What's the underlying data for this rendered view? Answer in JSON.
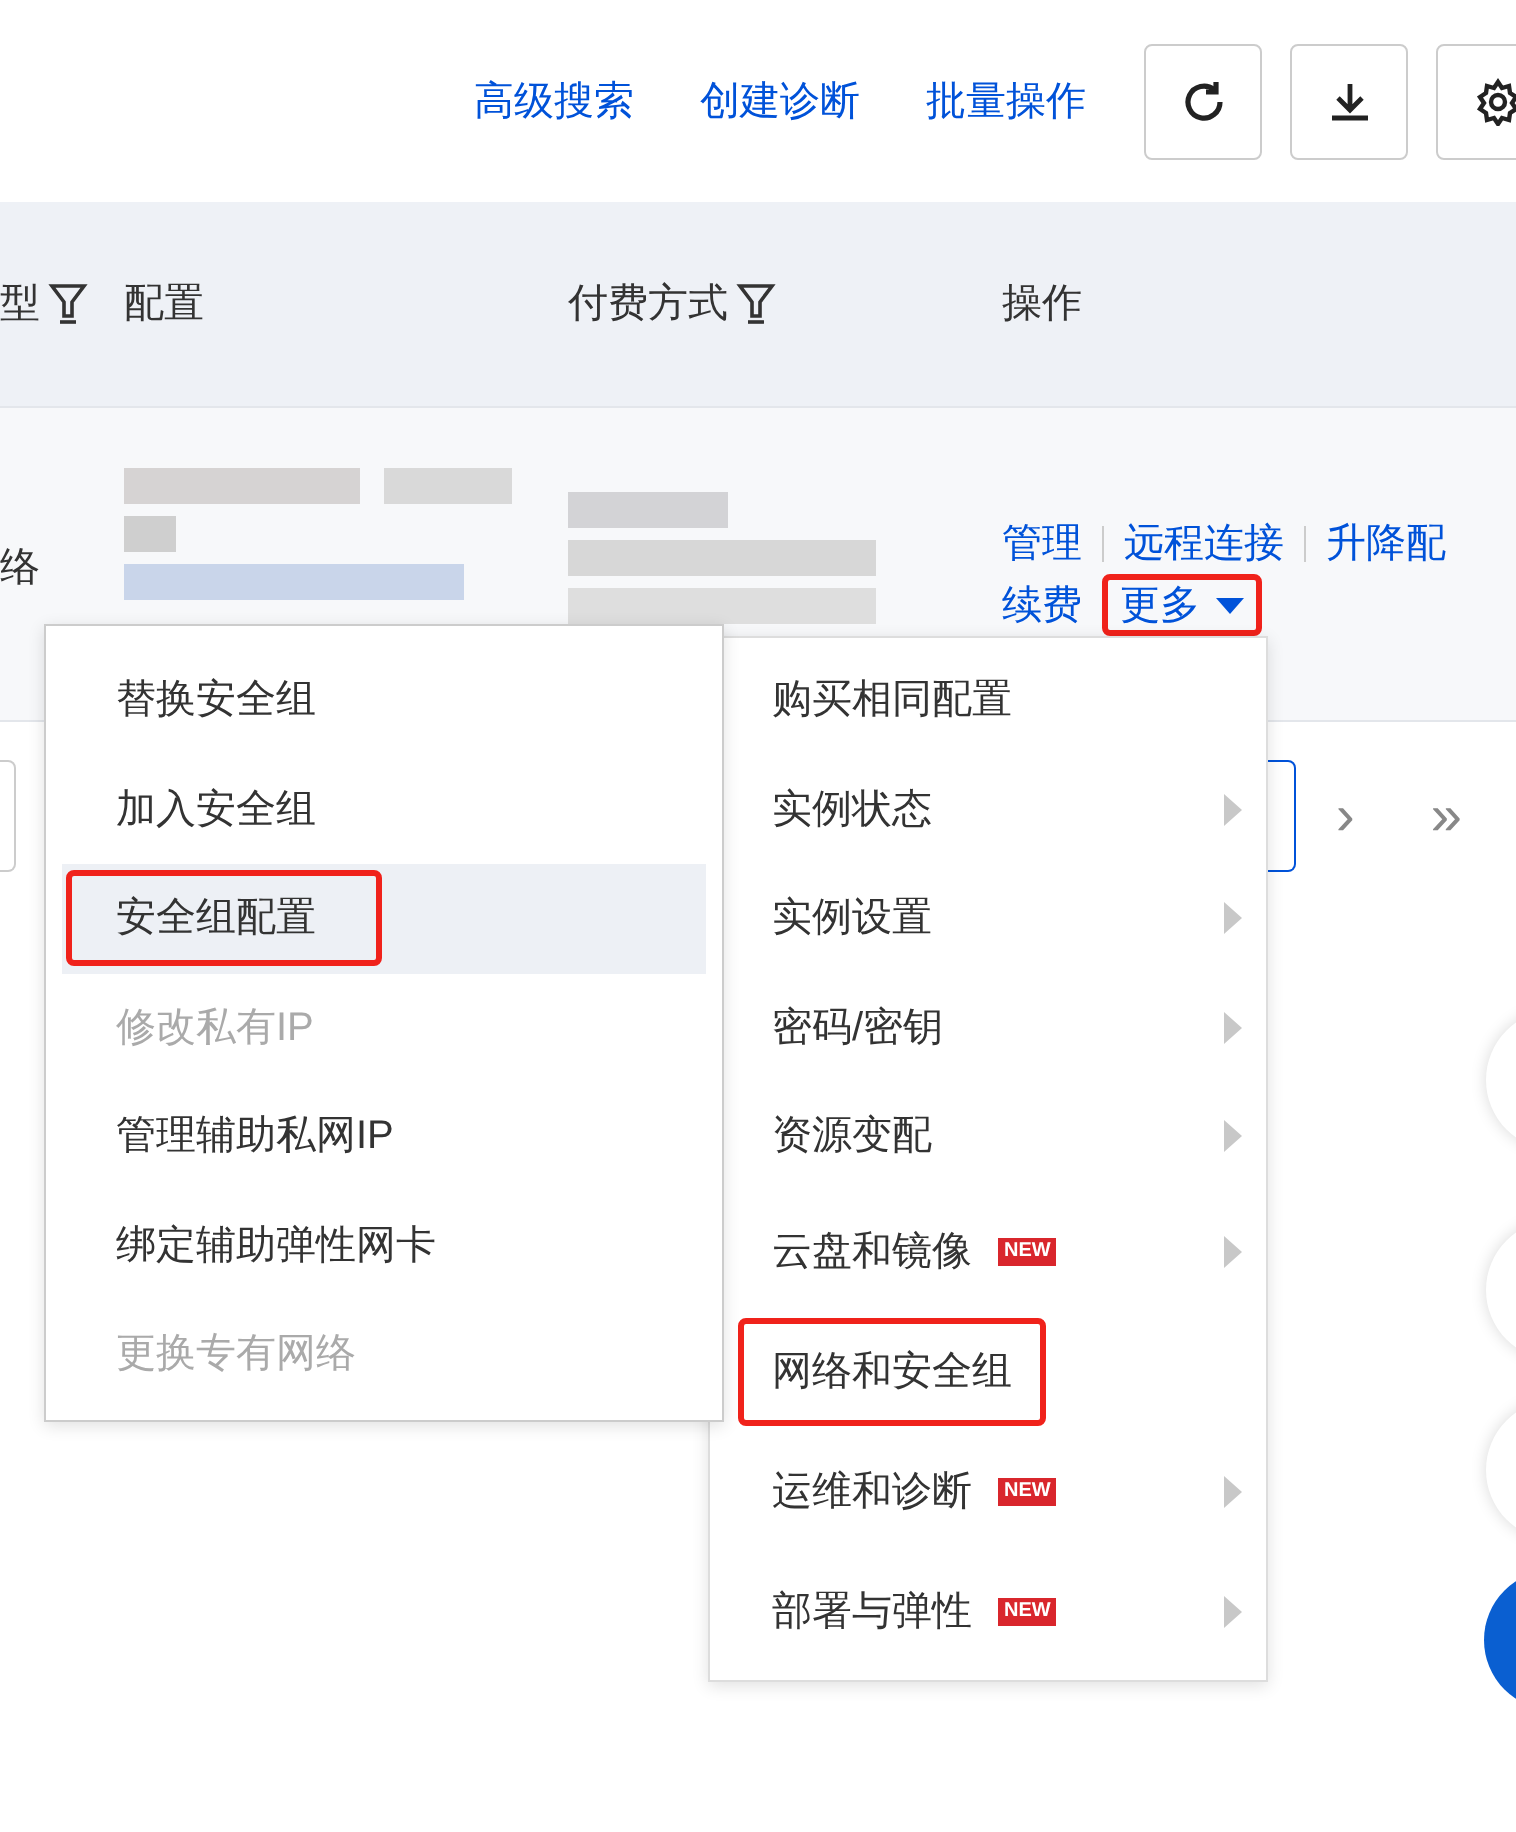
{
  "toolbar": {
    "links": [
      "高级搜索",
      "创建诊断",
      "批量操作"
    ]
  },
  "table": {
    "columns": [
      {
        "label": "型",
        "filter": true
      },
      {
        "label": "配置",
        "filter": false
      },
      {
        "label": "付费方式",
        "filter": true
      },
      {
        "label": "操作",
        "filter": false
      }
    ],
    "row": {
      "cell_1": "络",
      "actions": [
        [
          "管理",
          "远程连接",
          "升降配"
        ],
        [
          "续费"
        ]
      ],
      "more": {
        "label": "更多",
        "highlighted": true
      }
    }
  },
  "pagination": {
    "next": "›",
    "last": "»"
  },
  "submenu": [
    {
      "label": "替换安全组",
      "disabled": false,
      "hovered": false,
      "highlighted": false
    },
    {
      "label": "加入安全组",
      "disabled": false,
      "hovered": false,
      "highlighted": false
    },
    {
      "label": "安全组配置",
      "disabled": false,
      "hovered": true,
      "highlighted": true
    },
    {
      "label": "修改私有IP",
      "disabled": true,
      "hovered": false,
      "highlighted": false
    },
    {
      "label": "管理辅助私网IP",
      "disabled": false,
      "hovered": false,
      "highlighted": false
    },
    {
      "label": "绑定辅助弹性网卡",
      "disabled": false,
      "hovered": false,
      "highlighted": false
    },
    {
      "label": "更换专有网络",
      "disabled": true,
      "hovered": false,
      "highlighted": false
    }
  ],
  "menu": [
    {
      "label": "购买相同配置",
      "has_submenu": false,
      "highlighted": false
    },
    {
      "label": "实例状态",
      "has_submenu": true,
      "highlighted": false
    },
    {
      "label": "实例设置",
      "has_submenu": true,
      "highlighted": false
    },
    {
      "label": "密码/密钥",
      "has_submenu": true,
      "highlighted": false
    },
    {
      "label": "资源变配",
      "has_submenu": true,
      "highlighted": false
    },
    {
      "label": "云盘和镜像",
      "has_submenu": true,
      "highlighted": false,
      "badge": "NEW"
    },
    {
      "label": "网络和安全组",
      "has_submenu": false,
      "highlighted": true
    },
    {
      "label": "运维和诊断",
      "has_submenu": true,
      "highlighted": false,
      "badge": "NEW"
    },
    {
      "label": "部署与弹性",
      "has_submenu": true,
      "highlighted": false,
      "badge": "NEW"
    }
  ]
}
